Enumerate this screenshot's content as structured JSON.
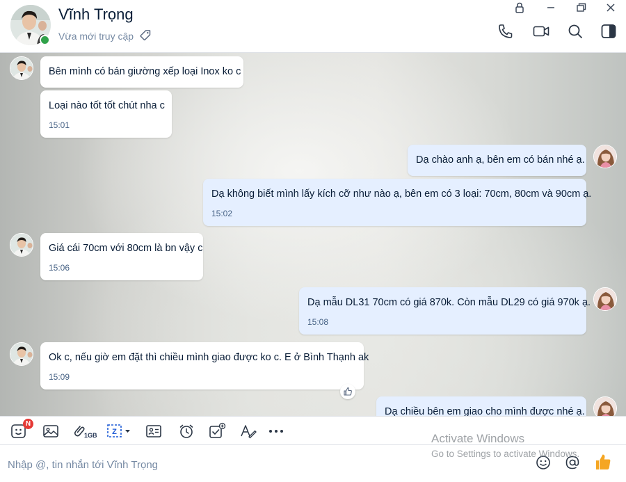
{
  "header": {
    "name": "Vĩnh Trọng",
    "status": "Vừa mới truy cập"
  },
  "messages": [
    {
      "dir": "in",
      "text": "Bên mình có bán giường xếp loại Inox ko c",
      "time": ""
    },
    {
      "dir": "in",
      "text": "Loại nào tốt tốt chút nha c",
      "time": "15:01"
    },
    {
      "dir": "out",
      "text": "Dạ chào anh ạ, bên em có bán nhé ạ.",
      "time": ""
    },
    {
      "dir": "out",
      "text": "Dạ không biết mình lấy kích cỡ như nào ạ, bên em có 3 loại: 70cm, 80cm và 90cm ạ.",
      "time": "15:02"
    },
    {
      "dir": "in",
      "text": "Giá cái 70cm với 80cm là bn vậy c",
      "time": "15:06"
    },
    {
      "dir": "out",
      "text": "Dạ mẫu DL31 70cm có giá 870k. Còn mẫu DL29 có giá 970k ạ.",
      "time": "15:08"
    },
    {
      "dir": "in",
      "text": "Ok c, nếu giờ em đặt thì chiều mình giao được ko c. E ở Bình Thạnh ak",
      "time": "15:09"
    },
    {
      "dir": "out",
      "text": "Dạ chiều bên em giao cho mình được nhé ạ.",
      "time": ""
    }
  ],
  "toolbar": {
    "sticker_badge": "N",
    "file_limit": "1GB"
  },
  "input": {
    "placeholder": "Nhập @, tin nhắn tới Vĩnh Trọng"
  },
  "watermark": {
    "title": "Activate Windows",
    "subtitle": "Go to Settings to activate Windows."
  },
  "colors": {
    "incoming_bubble": "#ffffff",
    "outgoing_bubble": "#e5efff",
    "online": "#30a24a",
    "like_thumb": "#f5a623",
    "badge": "#e53935"
  }
}
